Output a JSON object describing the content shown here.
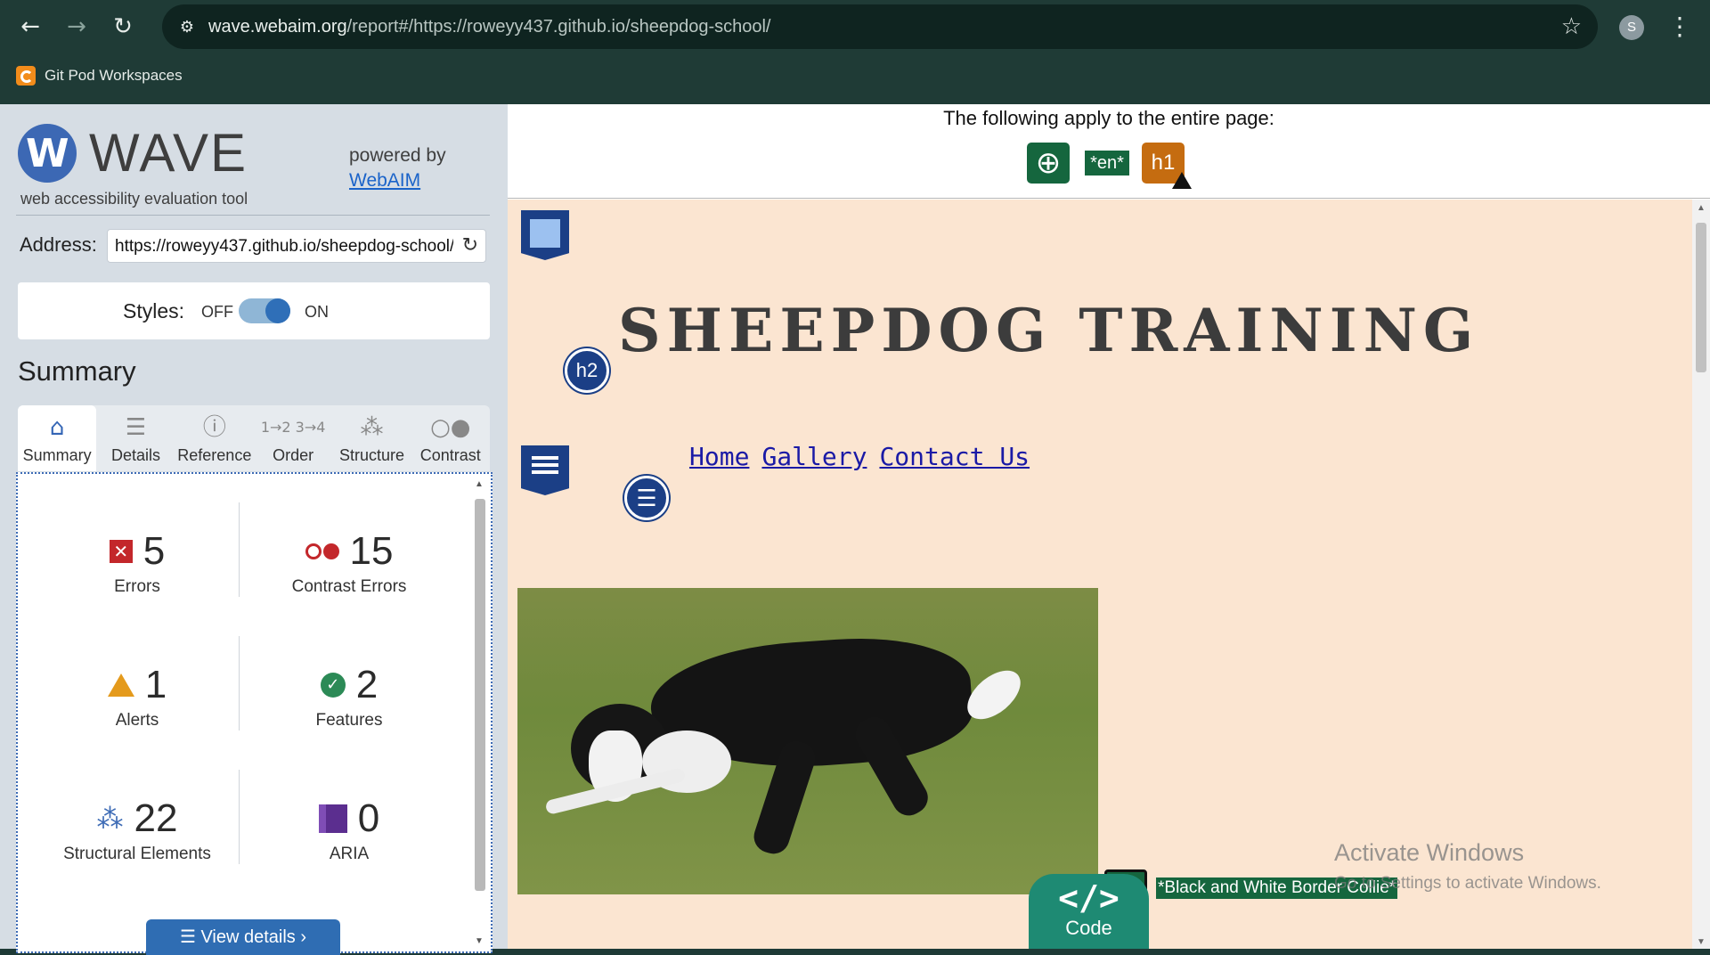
{
  "browser": {
    "url_host": "wave.webaim.org",
    "url_path": "/report#/https://roweyy437.github.io/sheepdog-school/",
    "profile_initial": "S",
    "bookmark_label": "Git Pod Workspaces"
  },
  "wave": {
    "title": "WAVE",
    "subtitle": "web accessibility evaluation tool",
    "powered_by": "powered by",
    "webaim_link": "WebAIM",
    "address_label": "Address:",
    "address_value": "https://roweyy437.github.io/sheepdog-school/",
    "styles_label": "Styles:",
    "styles_off": "OFF",
    "styles_on": "ON",
    "styles_enabled": true,
    "summary_heading": "Summary",
    "tabs": [
      {
        "label": "Summary",
        "icon": "home-icon",
        "active": true
      },
      {
        "label": "Details",
        "icon": "list-icon",
        "active": false
      },
      {
        "label": "Reference",
        "icon": "info-icon",
        "active": false
      },
      {
        "label": "Order",
        "icon": "order-icon",
        "active": false
      },
      {
        "label": "Structure",
        "icon": "structure-icon",
        "active": false
      },
      {
        "label": "Contrast",
        "icon": "contrast-icon",
        "active": false
      }
    ],
    "stats": {
      "errors": {
        "count": "5",
        "label": "Errors",
        "color": "#c3272b"
      },
      "contrast": {
        "count": "15",
        "label": "Contrast Errors",
        "color": "#c3272b"
      },
      "alerts": {
        "count": "1",
        "label": "Alerts",
        "color": "#e49a1c"
      },
      "features": {
        "count": "2",
        "label": "Features",
        "color": "#2c8a56"
      },
      "structure": {
        "count": "22",
        "label": "Structural Elements",
        "color": "#3d6bb5"
      },
      "aria": {
        "count": "0",
        "label": "ARIA",
        "color": "#5b2e8f"
      }
    },
    "view_details": "View details ›"
  },
  "page": {
    "banner_text": "The following apply to the entire page:",
    "lang_badge": "*en*",
    "h1_badge": "h1",
    "h2_badge": "h2",
    "site_title": "SHEEPDOG TRAINING",
    "nav_links": [
      "Home",
      "Gallery",
      "Contact Us"
    ],
    "alt_text": "*Black and White Border Collie*",
    "code_label": "Code",
    "code_glyph": "</>"
  },
  "windows": {
    "activate_title": "Activate Windows",
    "activate_sub": "Go to Settings to activate Windows."
  }
}
